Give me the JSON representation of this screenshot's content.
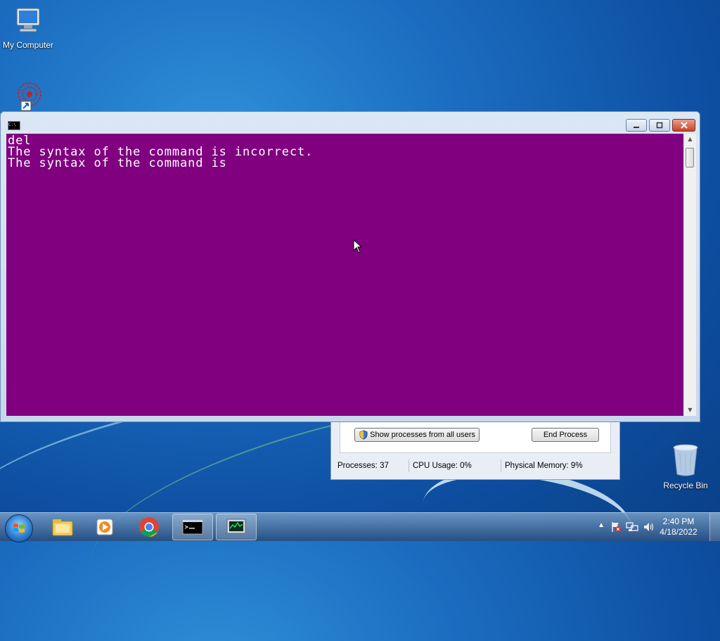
{
  "desktop": {
    "icons": [
      {
        "label": "My Computer",
        "icon": "computer-icon"
      },
      {
        "label": "",
        "icon": "shortcut-app-icon"
      },
      {
        "label": "Recycle Bin",
        "icon": "recycle-bin-icon"
      }
    ]
  },
  "console": {
    "lines": "del\nThe syntax of the command is incorrect.\nThe syntax of the command is",
    "background": "#800080",
    "text_color": "#ffffff"
  },
  "task_manager": {
    "show_all_label": "Show processes from all users",
    "end_process_label": "End Process",
    "processes": "Processes: 37",
    "cpu": "CPU Usage: 0%",
    "memory": "Physical Memory: 9%"
  },
  "taskbar": {
    "pinned": [
      "start-orb",
      "file-explorer-icon",
      "media-player-icon",
      "chrome-icon",
      "command-prompt-icon",
      "task-manager-icon"
    ],
    "time": "2:40 PM",
    "date": "4/18/2022"
  }
}
